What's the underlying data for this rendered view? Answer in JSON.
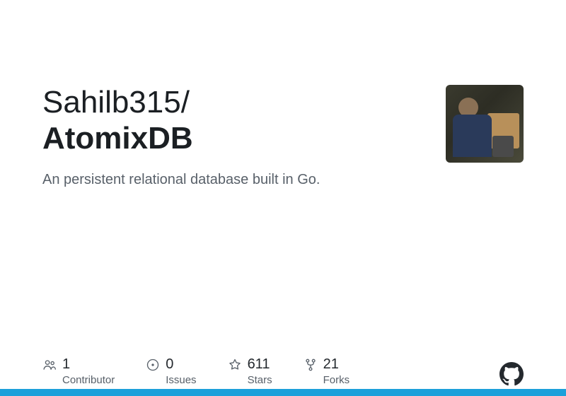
{
  "repo": {
    "owner": "Sahilb315",
    "name": "AtomixDB",
    "description": "An persistent relational database built in Go."
  },
  "stats": {
    "contributors": {
      "value": "1",
      "label": "Contributor"
    },
    "issues": {
      "value": "0",
      "label": "Issues"
    },
    "stars": {
      "value": "611",
      "label": "Stars"
    },
    "forks": {
      "value": "21",
      "label": "Forks"
    }
  }
}
